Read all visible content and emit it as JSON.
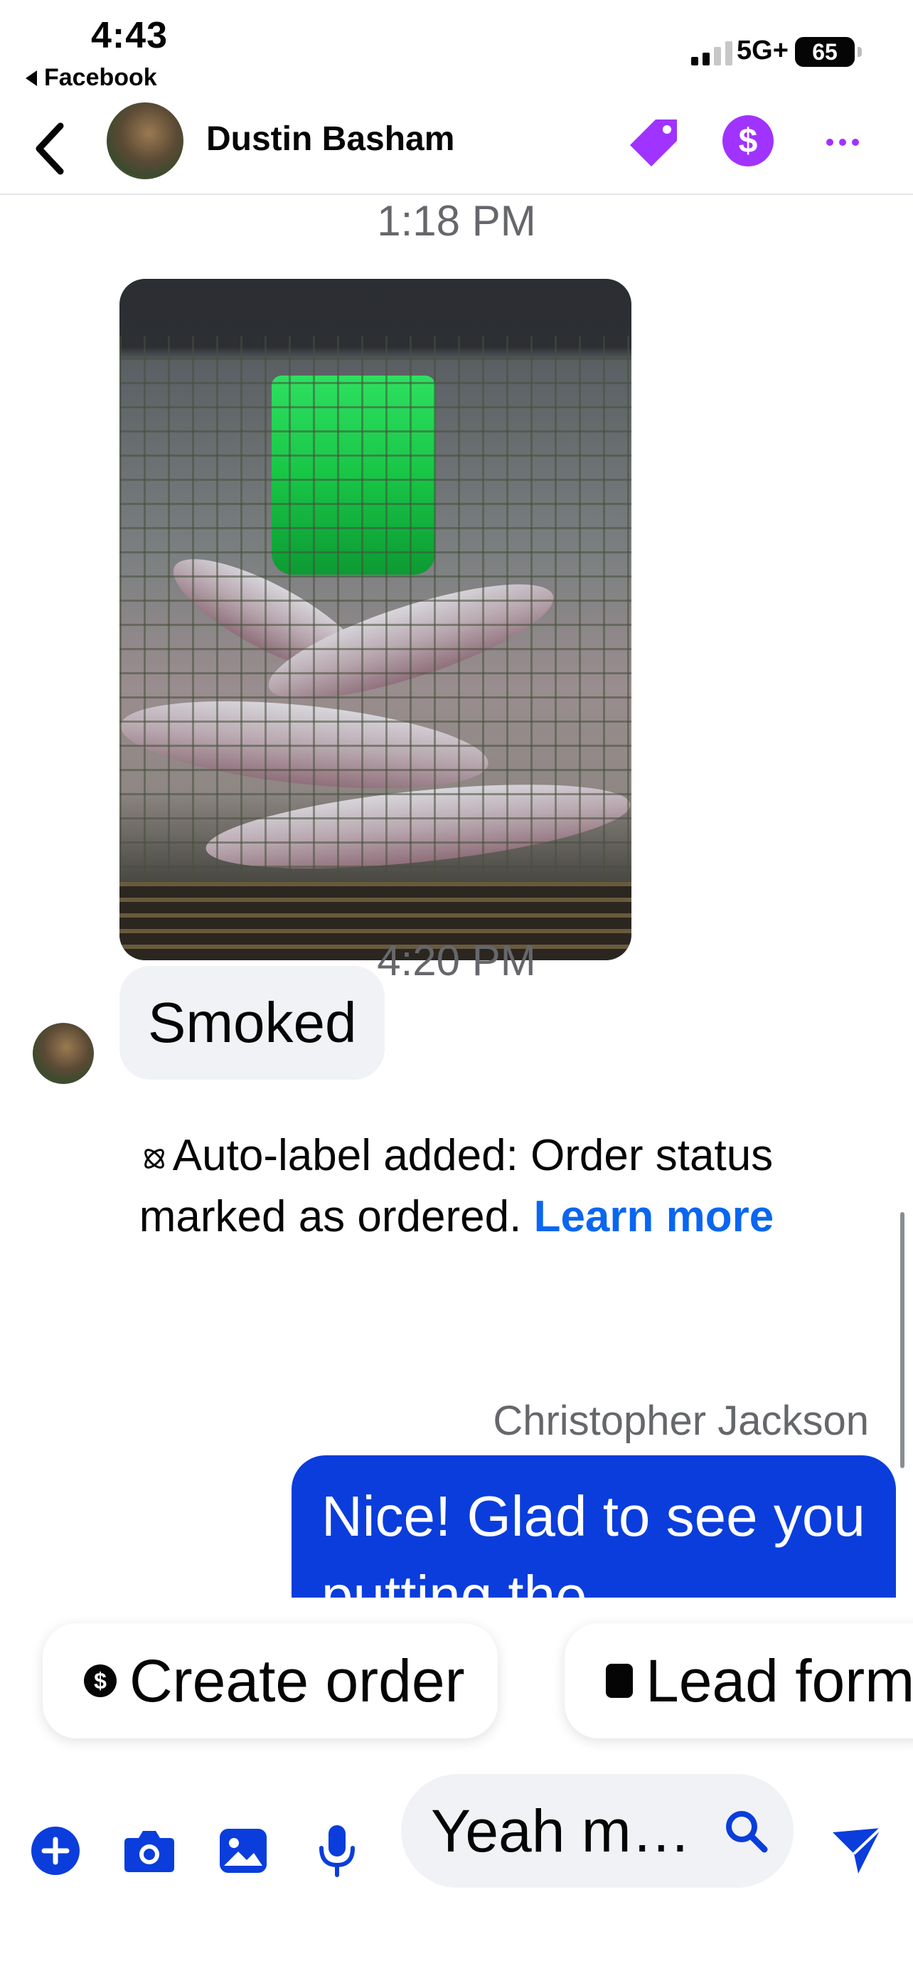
{
  "status_bar": {
    "time": "4:43",
    "back_app": "Facebook",
    "network": "5G+",
    "battery": "65"
  },
  "header": {
    "contact_name": "Dustin Basham",
    "accent_color": "#a033ff"
  },
  "chat": {
    "timestamp_1": "1:18 PM",
    "incoming_message": "Smoked",
    "system_message": "Auto-label added: Order status marked as ordered.",
    "system_link": "Learn more",
    "timestamp_2": "4:20 PM",
    "sender_name": "Christopher Jackson",
    "outgoing_message": "Nice! Glad to see you putting the"
  },
  "quick_replies": [
    {
      "label": "Create order",
      "icon": "dollar-icon"
    },
    {
      "label": "Lead form",
      "icon": "form-icon"
    }
  ],
  "composer": {
    "input_value": "Yeah m…",
    "accent_color": "#0a3ddb"
  }
}
